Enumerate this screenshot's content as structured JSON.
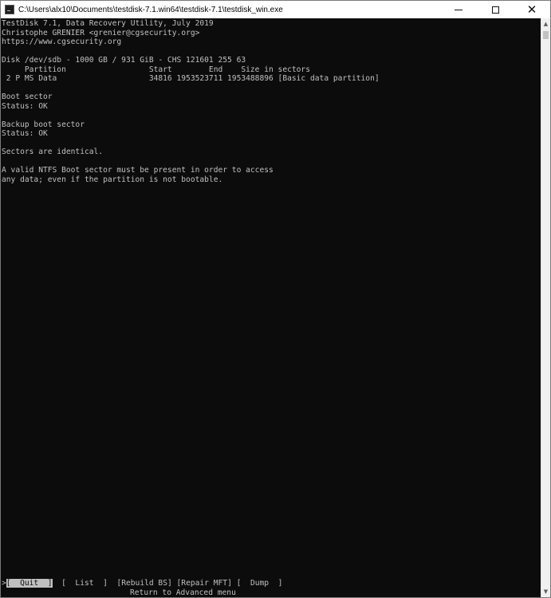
{
  "window": {
    "title": "C:\\Users\\alx10\\Documents\\testdisk-7.1.win64\\testdisk-7.1\\testdisk_win.exe"
  },
  "console": {
    "lines": [
      "TestDisk 7.1, Data Recovery Utility, July 2019",
      "Christophe GRENIER <grenier@cgsecurity.org>",
      "https://www.cgsecurity.org",
      "",
      "Disk /dev/sdb - 1000 GB / 931 GiB - CHS 121601 255 63",
      "     Partition                  Start        End    Size in sectors",
      " 2 P MS Data                    34816 1953523711 1953488896 [Basic data partition]",
      "",
      "Boot sector",
      "Status: OK",
      "",
      "Backup boot sector",
      "Status: OK",
      "",
      "Sectors are identical.",
      "",
      "A valid NTFS Boot sector must be present in order to access",
      "any data; even if the partition is not bootable."
    ]
  },
  "menu": {
    "cursor": ">",
    "quit": "[  Quit  ]",
    "list": "[  List  ]",
    "rebuild_bs": "[Rebuild BS]",
    "repair_mft": "[Repair MFT]",
    "dump": "[  Dump  ]",
    "hint": "Return to Advanced menu"
  }
}
